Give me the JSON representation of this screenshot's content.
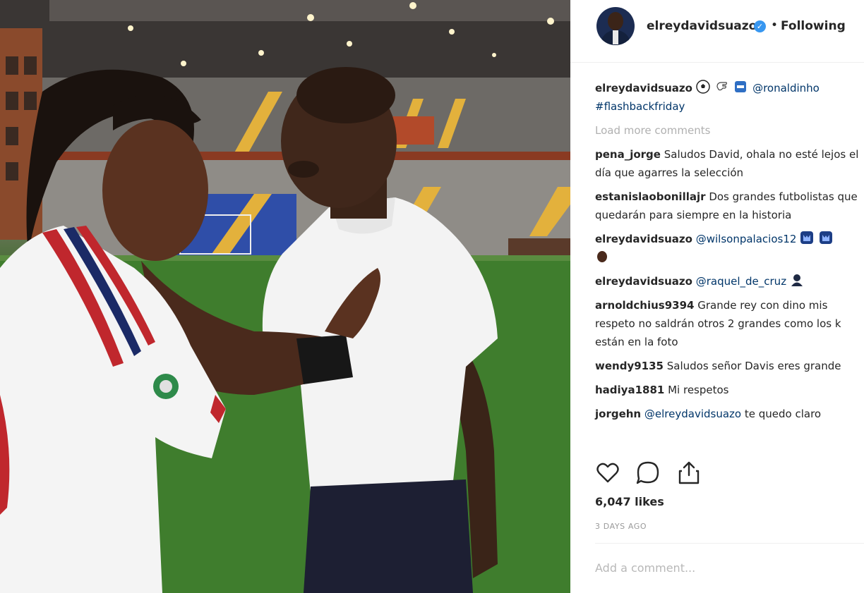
{
  "post": {
    "username": "elreydavidsuazo",
    "verified_mark": "✓",
    "separator": "•",
    "follow_status": "Following"
  },
  "caption": {
    "username": "elreydavidsuazo",
    "emojis": [
      "soccer-ball",
      "hand-emoji",
      "flag-emoji"
    ],
    "mention": "@ronaldinho",
    "hashtag": "#flashbackfriday"
  },
  "load_more": "Load more comments",
  "comments": [
    {
      "user": "pena_jorge",
      "text": "Saludos David, ohala no esté lejos el día que agarres la selección"
    },
    {
      "user": "estanislaobonillajr",
      "text": "Dos grandes futbolistas que quedarán para siempre en la historia"
    },
    {
      "user": "elreydavidsuazo",
      "mention": "@wilsonpalacios12",
      "emojis": [
        "blue-heart-emoji",
        "blue-heart-emoji",
        "brown-hand-emoji"
      ]
    },
    {
      "user": "elreydavidsuazo",
      "mention": "@raquel_de_cruz",
      "emojis": [
        "person-emoji"
      ]
    },
    {
      "user": "arnoldchius9394",
      "text": "Grande rey con dino mis respeto no saldrán otros 2 grandes como los k están en la foto"
    },
    {
      "user": "wendy9135",
      "text": "Saludos señor Davis eres grande"
    },
    {
      "user": "hadiya1881",
      "text": "Mi respetos"
    },
    {
      "user": "jorgehn",
      "mention": "@elreydavidsuazo",
      "text": "te quedo claro"
    }
  ],
  "likes": "6,047 likes",
  "time_ago": "3 DAYS AGO",
  "add_comment_placeholder": "Add a comment...",
  "colors": {
    "link": "#003569",
    "verified": "#3897f0",
    "muted": "#b0b0b0",
    "pitch": "#3d7a2b",
    "stadium_seats_blue": "#2f4ea8",
    "stadium_seats_yellow": "#e3b13c"
  }
}
